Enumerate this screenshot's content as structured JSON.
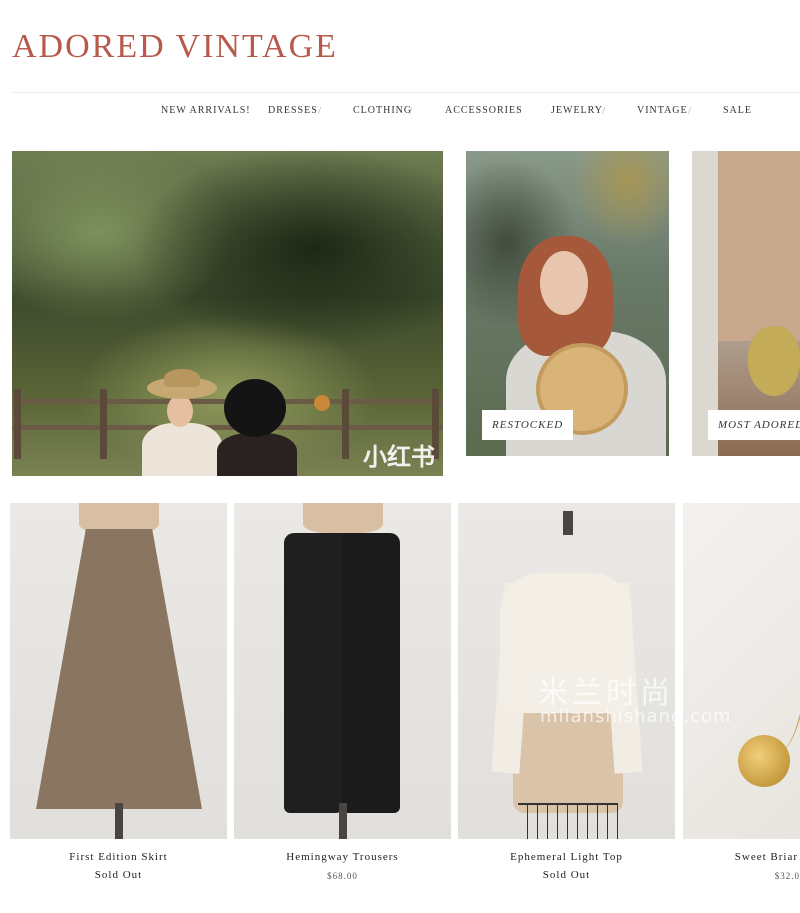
{
  "site": {
    "logo": "ADORED VINTAGE"
  },
  "nav": {
    "items": [
      {
        "label": "NEW ARRIVALS!"
      },
      {
        "label": "DRESSES"
      },
      {
        "label": "CLOTHING"
      },
      {
        "label": "ACCESSORIES"
      },
      {
        "label": "JEWELRY"
      },
      {
        "label": "VINTAGE"
      },
      {
        "label": "SALE"
      }
    ],
    "separator": "/"
  },
  "hero": {
    "labels": {
      "restocked": "RESTOCKED",
      "most_adored": "MOST ADORED"
    },
    "watermark": "小红书"
  },
  "watermark": {
    "text": "米兰时尚",
    "sub": "milanshishang.com"
  },
  "products": [
    {
      "name": "First Edition Skirt",
      "price": "Sold Out"
    },
    {
      "name": "Hemingway Trousers",
      "price": "$68.00"
    },
    {
      "name": "Ephemeral Light Top",
      "price": "Sold Out"
    },
    {
      "name": "Sweet Briar",
      "price": "$32.0"
    }
  ],
  "colors": {
    "brand": "#b65a4c",
    "text": "#333333",
    "background": "#ffffff"
  }
}
